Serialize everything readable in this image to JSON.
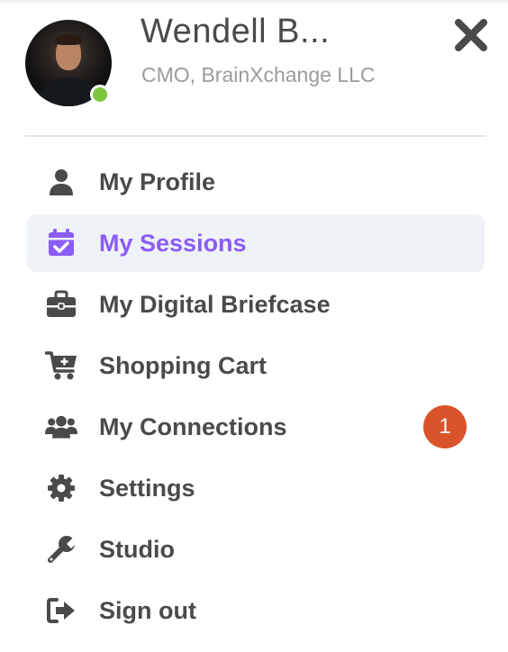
{
  "profile": {
    "name": "Wendell B...",
    "title": "CMO, BrainXchange LLC",
    "status": "online"
  },
  "colors": {
    "accent": "#8b5cf6",
    "active_bg": "#eff2f7",
    "badge": "#d9532b",
    "online": "#7cc63f",
    "text": "#4a4a4a",
    "muted": "#9b9b9b"
  },
  "menu": [
    {
      "label": "My Profile",
      "icon": "user-icon",
      "active": false
    },
    {
      "label": "My Sessions",
      "icon": "calendar-check-icon",
      "active": true
    },
    {
      "label": "My Digital Briefcase",
      "icon": "briefcase-icon",
      "active": false
    },
    {
      "label": "Shopping Cart",
      "icon": "cart-plus-icon",
      "active": false
    },
    {
      "label": "My Connections",
      "icon": "users-icon",
      "active": false,
      "badge": "1"
    },
    {
      "label": "Settings",
      "icon": "gear-icon",
      "active": false
    },
    {
      "label": "Studio",
      "icon": "wrench-icon",
      "active": false
    },
    {
      "label": "Sign out",
      "icon": "sign-out-icon",
      "active": false
    }
  ]
}
